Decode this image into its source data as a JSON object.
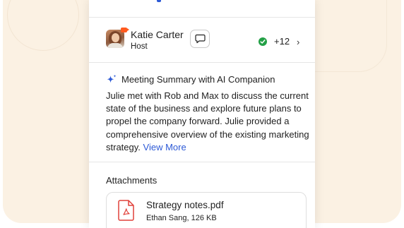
{
  "host": {
    "name": "Katie Carter",
    "role": "Host",
    "participant_count": "+12"
  },
  "summary": {
    "title": "Meeting Summary with AI Companion",
    "body": "Julie met with Rob and Max to discuss the current state of the business and explore future plans to propel the company forward. Julie provided a comprehensive overview of the existing marketing strategy.",
    "view_more": "View More"
  },
  "attachments": {
    "title": "Attachments",
    "file_name": "Strategy notes.pdf",
    "file_meta": "Ethan Sang, 126 KB"
  },
  "icons": {
    "chat": "chat-bubble-icon",
    "status": "check-circle-icon",
    "chevron": "chevron-right-icon",
    "sparkle": "ai-sparkle-icon",
    "file": "pdf-file-icon",
    "video": "video-camera-icon"
  },
  "colors": {
    "background": "#fbf1e3",
    "link": "#2d5ad6",
    "success": "#23a046",
    "camera_badge": "#ff5a1f",
    "pdf": "#e0413a"
  }
}
